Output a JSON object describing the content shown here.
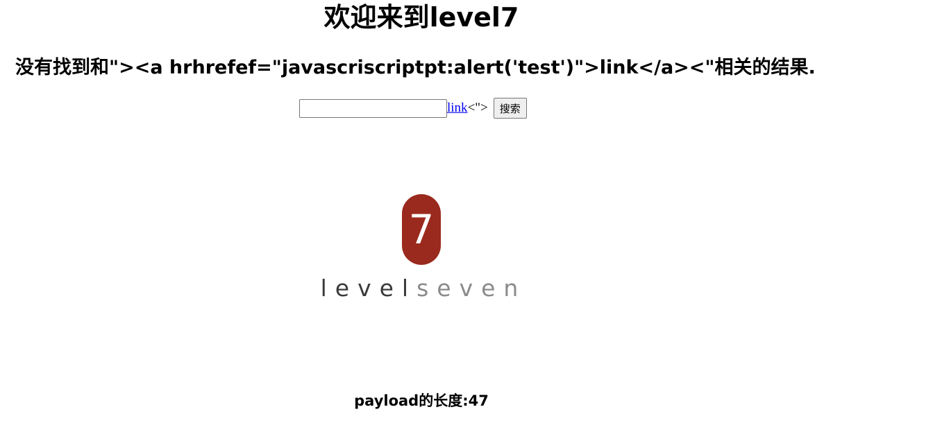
{
  "page_title": "欢迎来到level7",
  "result": {
    "message": "没有找到和\"><a hrhrefef=\"javascriscriptpt:alert('test')\">link</a><\"相关的结果."
  },
  "search": {
    "input_value": "",
    "link_text": "link",
    "trailing_text": "<\">",
    "button_label": "搜索"
  },
  "logo": {
    "badge_number": "7",
    "word_part1": "level",
    "word_part2": "seven",
    "colors": {
      "badge": "#9a2a1d",
      "word_dark": "#3a3a3a",
      "word_light": "#8a8a8a"
    }
  },
  "payload_length_text": "payload的长度:47",
  "colors": {
    "link": "#0000ee",
    "button_bg": "#efefef"
  }
}
